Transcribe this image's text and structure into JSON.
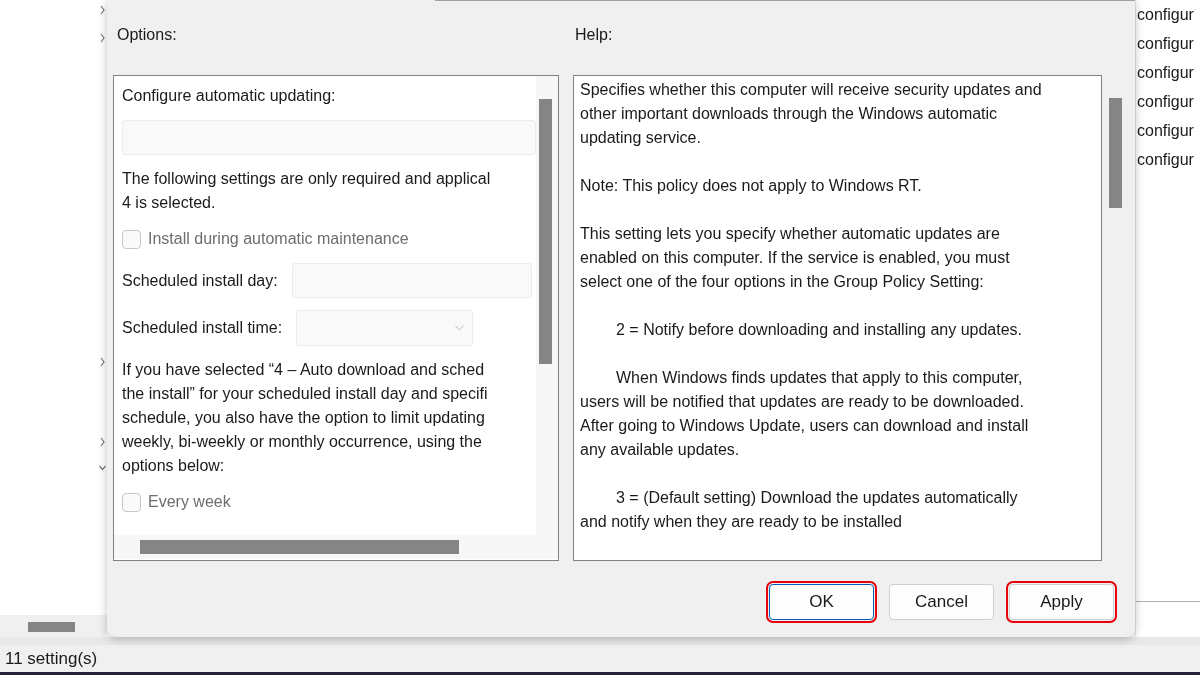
{
  "sidebar": {
    "tree_toggles": [
      {
        "expanded": false
      },
      {
        "expanded": false
      },
      {
        "expanded": false
      },
      {
        "expanded": false
      },
      {
        "expanded": true
      }
    ]
  },
  "dialog": {
    "options": {
      "title": "Options:",
      "items": [
        {
          "kind": "label",
          "text": "Configure automatic updating:"
        },
        {
          "kind": "field",
          "disabled": true
        },
        {
          "kind": "paragraph",
          "lines": [
            "The following settings are only required and applical",
            "4 is selected."
          ]
        },
        {
          "kind": "checkbox",
          "label": "Install during automatic maintenance",
          "checked": false,
          "disabled": true
        },
        {
          "kind": "field_row",
          "label": "Scheduled install day:",
          "disabled": true
        },
        {
          "kind": "dropdown_row",
          "label": "Scheduled install time:",
          "disabled": true
        },
        {
          "kind": "paragraph",
          "lines": [
            "If you have selected “4 – Auto download and sched",
            "the install” for your scheduled install day and specifi",
            "schedule, you also have the option to limit updating",
            "weekly, bi-weekly or monthly occurrence, using the",
            "options below:"
          ]
        },
        {
          "kind": "checkbox",
          "label": "Every week",
          "checked": false,
          "disabled": true
        }
      ]
    },
    "help": {
      "title": "Help:",
      "paragraphs": [
        {
          "indented": false,
          "lines": [
            "Specifies whether this computer will receive security updates and",
            "other important downloads through the Windows automatic",
            "updating service."
          ]
        },
        {
          "indented": false,
          "lines": [
            "Note: This policy does not apply to Windows RT."
          ]
        },
        {
          "indented": false,
          "lines": [
            "This setting lets you specify whether automatic updates are",
            "enabled on this computer. If the service is enabled, you must",
            "select one of the four options in the Group Policy Setting:"
          ]
        },
        {
          "indented": true,
          "lines": [
            "2 = Notify before downloading and installing any updates."
          ]
        },
        {
          "indented": true,
          "lines": [
            "When Windows finds updates that apply to this computer,",
            "users will be notified that updates are ready to be downloaded.",
            "After going to Windows Update, users can download and install",
            "any available updates."
          ]
        },
        {
          "indented": true,
          "lines": [
            "3 = (Default setting) Download the updates automatically",
            "and notify when they are ready to be installed"
          ]
        }
      ]
    },
    "buttons": [
      {
        "label": "OK",
        "default": true,
        "highlighted": true
      },
      {
        "label": "Cancel",
        "default": false,
        "highlighted": false
      },
      {
        "label": "Apply",
        "default": false,
        "highlighted": true
      }
    ]
  },
  "right_list": {
    "items": [
      "configur",
      "configur",
      "configur",
      "configur",
      "configur",
      "configur"
    ]
  },
  "status_bar": {
    "text": "11 setting(s)"
  }
}
